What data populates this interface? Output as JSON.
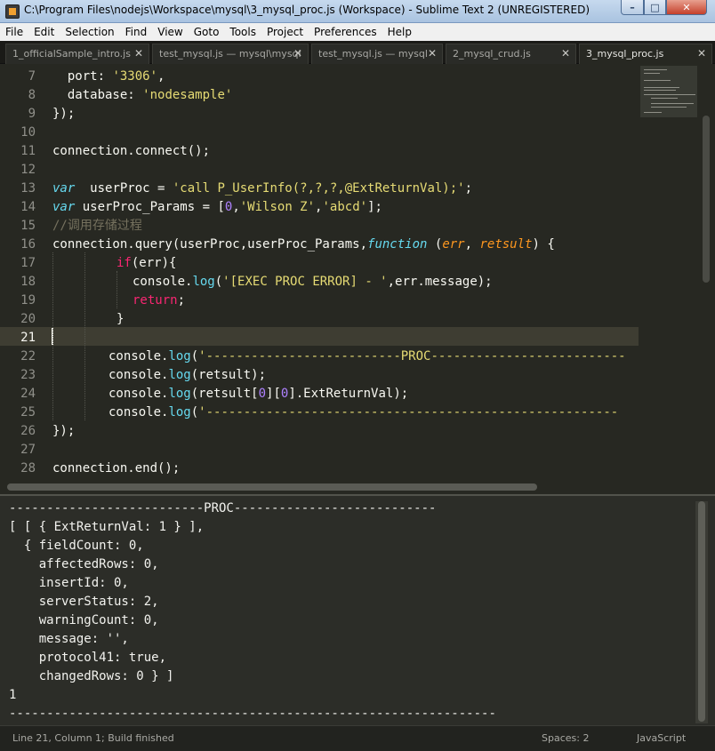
{
  "window": {
    "title": "C:\\Program Files\\nodejs\\Workspace\\mysql\\3_mysql_proc.js (Workspace) - Sublime Text 2 (UNREGISTERED)",
    "min_glyph": "–",
    "max_glyph": "□",
    "close_glyph": "✕"
  },
  "menu": [
    "File",
    "Edit",
    "Selection",
    "Find",
    "View",
    "Goto",
    "Tools",
    "Project",
    "Preferences",
    "Help"
  ],
  "tabs": [
    {
      "label": "1_officialSample_intro.js",
      "close": "✕",
      "active": false
    },
    {
      "label": "test_mysql.js — mysql\\mysql",
      "close": "✕",
      "active": false
    },
    {
      "label": "test_mysql.js — mysql",
      "close": "✕",
      "active": false
    },
    {
      "label": "2_mysql_crud.js",
      "close": "✕",
      "active": false
    },
    {
      "label": "3_mysql_proc.js",
      "close": "✕",
      "active": true
    }
  ],
  "editor": {
    "line_numbers": [
      "7",
      "8",
      "9",
      "10",
      "11",
      "12",
      "13",
      "14",
      "15",
      "16",
      "17",
      "18",
      "19",
      "20",
      "21",
      "22",
      "23",
      "24",
      "25",
      "26",
      "27",
      "28"
    ],
    "current_line": "21",
    "code": {
      "l7a": "  port: ",
      "l7b": "'3306'",
      "l7c": ",",
      "l8a": "  database: ",
      "l8b": "'nodesample'",
      "l9": "});",
      "l11": "connection.connect();",
      "l13a": "var",
      "l13b": "  userProc = ",
      "l13c": "'call P_UserInfo(?,?,?,@ExtReturnVal);'",
      "l13d": ";",
      "l14a": "var",
      "l14b": " userProc_Params = [",
      "l14c": "0",
      "l14d": ",",
      "l14e": "'Wilson Z'",
      "l14f": ",",
      "l14g": "'abcd'",
      "l14h": "];",
      "l15": "//调用存储过程",
      "l16a": "connection.query(userProc,userProc_Params,",
      "l16b": "function",
      "l16c": " (",
      "l16d": "err",
      "l16e": ", ",
      "l16f": "retsult",
      "l16g": ") {",
      "l17a": "if",
      "l17b": "(err){",
      "l18a": "console.",
      "l18b": "log",
      "l18c": "(",
      "l18d": "'[EXEC PROC ERROR] - '",
      "l18e": ",err.message);",
      "l19a": "return",
      "l19b": ";",
      "l20": "}",
      "l22a": "console.",
      "l22b": "log",
      "l22c": "(",
      "l22d": "'--------------------------PROC--------------------------",
      "l23a": "console.",
      "l23b": "log",
      "l23c": "(retsult);",
      "l24a": "console.",
      "l24b": "log",
      "l24c": "(retsult[",
      "l24d": "0",
      "l24e": "][",
      "l24f": "0",
      "l24g": "].ExtReturnVal);",
      "l25a": "console.",
      "l25b": "log",
      "l25c": "(",
      "l25d": "'-------------------------------------------------------",
      "l26": "});",
      "l28": "connection.end();"
    }
  },
  "console_output": [
    "--------------------------PROC---------------------------",
    "[ [ { ExtReturnVal: 1 } ],",
    "  { fieldCount: 0,",
    "    affectedRows: 0,",
    "    insertId: 0,",
    "    serverStatus: 2,",
    "    warningCount: 0,",
    "    message: '',",
    "    protocol41: true,",
    "    changedRows: 0 } ]",
    "1",
    "-----------------------------------------------------------------"
  ],
  "status": {
    "position": "Line 21, Column 1; Build finished",
    "indent": "Spaces: 2",
    "syntax": "JavaScript"
  },
  "colors": {
    "editor_bg": "#272822",
    "keyword": "#66d9ef",
    "string": "#e6db74",
    "number": "#ae81ff",
    "comment": "#75715e",
    "control": "#f92672",
    "param": "#fd971f"
  }
}
